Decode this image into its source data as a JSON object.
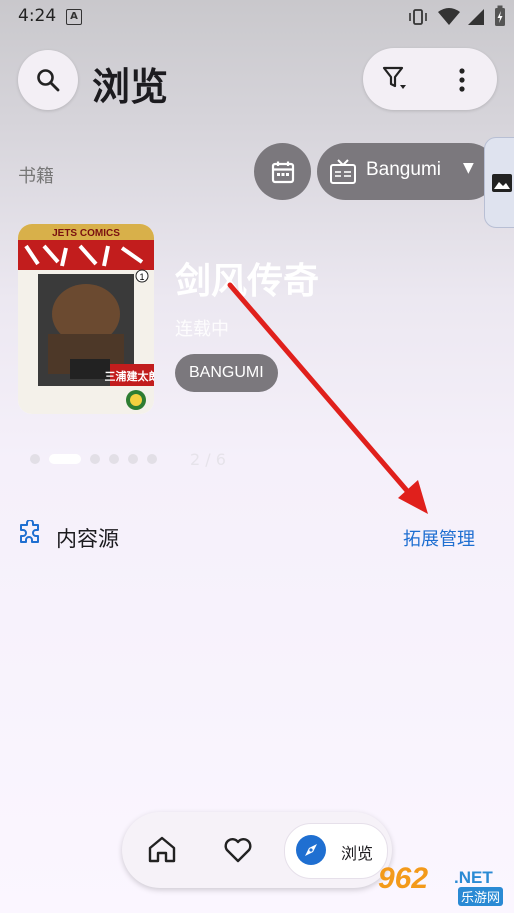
{
  "status_bar": {
    "time": "4:24",
    "notification_letter": "A",
    "icons": [
      "vibrate-icon",
      "wifi-icon",
      "signal-icon",
      "battery-icon"
    ]
  },
  "header": {
    "title": "浏览",
    "search_icon": "search-icon",
    "filter_icon": "filter-icon",
    "more_icon": "more-vert-icon"
  },
  "category_row": {
    "section_label": "书籍",
    "calendar_icon": "calendar-icon",
    "source_selector": {
      "icon": "tv-icon",
      "label": "Bangumi",
      "caret": "▼"
    },
    "image_tab_icon": "image-icon"
  },
  "featured": {
    "title": "剑风传奇",
    "status": "连载中",
    "tag": "BANGUMI",
    "cover_text": "三浦建太郎",
    "pager": {
      "total_dots": 6,
      "active_index": 1,
      "counter": "2 / 6"
    }
  },
  "section": {
    "title": "内容源",
    "icon": "extension-icon",
    "action_label": "拓展管理"
  },
  "bottom_nav": {
    "items": [
      {
        "id": "home",
        "icon": "home-icon",
        "label": ""
      },
      {
        "id": "favorites",
        "icon": "heart-icon",
        "label": ""
      },
      {
        "id": "browse",
        "icon": "compass-icon",
        "label": "浏览"
      }
    ],
    "active": "browse"
  },
  "watermark": {
    "main": "962",
    "net": ".NET",
    "sub": "乐游网"
  },
  "colors": {
    "accent_link": "#1f6fd1",
    "chip_bg": "#7b787d",
    "arrow": "#e0201c",
    "compass": "#1f6fd1"
  }
}
